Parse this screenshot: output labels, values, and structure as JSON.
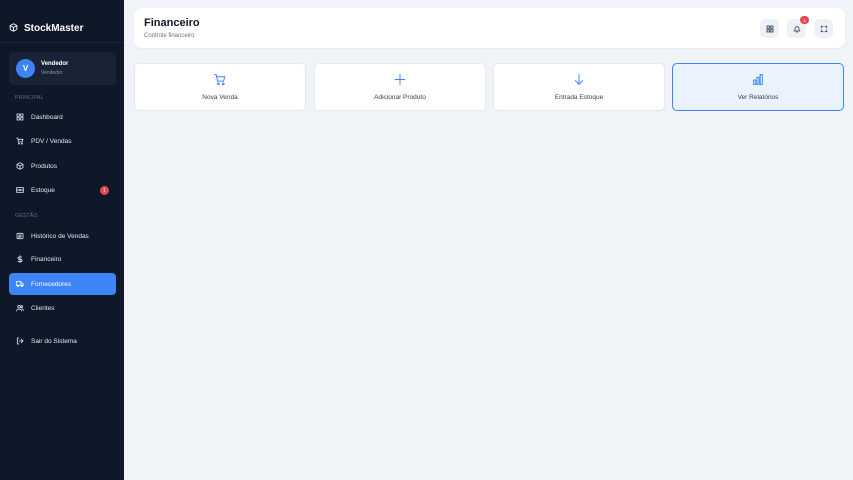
{
  "app": {
    "name": "StockMaster"
  },
  "user": {
    "initial": "V",
    "name": "Vendedor",
    "role": "Vendedor"
  },
  "sidebar": {
    "sections": [
      "PRINCIPAL",
      "GESTÃO"
    ],
    "items": [
      {
        "label": "Dashboard",
        "icon": "grid-icon"
      },
      {
        "label": "PDV / Vendas",
        "icon": "cart-icon"
      },
      {
        "label": "Produtos",
        "icon": "box-icon"
      },
      {
        "label": "Estoque",
        "icon": "warehouse-icon",
        "badge": "1"
      },
      {
        "label": "Histórico de Vendas",
        "icon": "receipt-icon"
      },
      {
        "label": "Financeiro",
        "icon": "dollar-icon"
      },
      {
        "label": "Fornecedores",
        "icon": "truck-icon",
        "active": true
      },
      {
        "label": "Clientes",
        "icon": "users-icon"
      },
      {
        "label": "Sair do Sistema",
        "icon": "logout-icon"
      }
    ]
  },
  "header": {
    "title": "Financeiro",
    "subtitle": "Controle financeiro",
    "notification_count": "1"
  },
  "quick_actions": [
    {
      "label": "Nova Venda",
      "icon": "cart-icon"
    },
    {
      "label": "Adicionar Produto",
      "icon": "plus-icon"
    },
    {
      "label": "Entrada Estoque",
      "icon": "arrow-down-icon"
    },
    {
      "label": "Ver Relatórios",
      "icon": "bar-chart-icon",
      "active": true
    }
  ],
  "colors": {
    "sidebar": "#0f1829",
    "accent": "#3d84f6",
    "badge": "#e5484d",
    "background": "#f0f4f9"
  }
}
